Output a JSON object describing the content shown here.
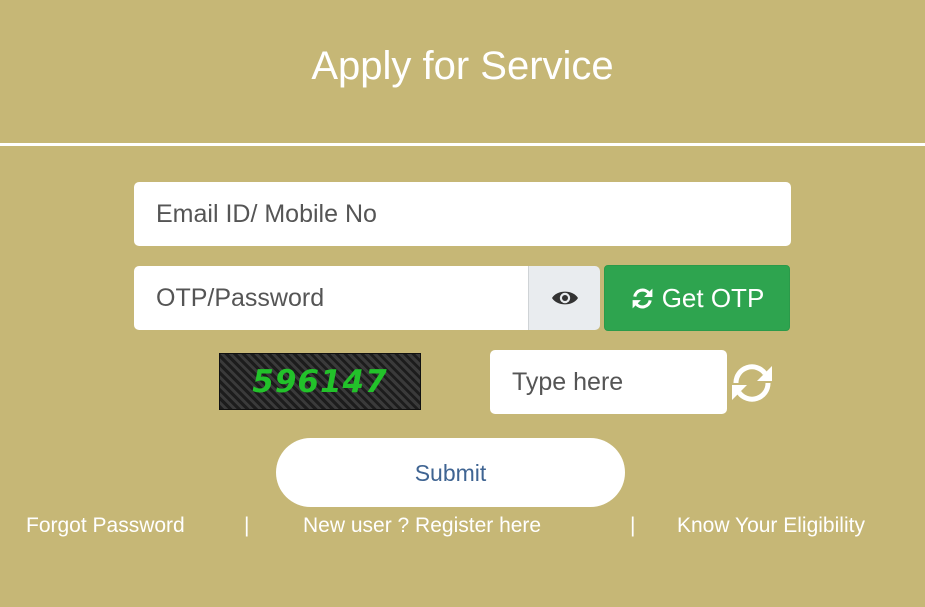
{
  "page": {
    "title": "Apply for Service"
  },
  "form": {
    "email_placeholder": "Email ID/ Mobile No",
    "otp_placeholder": "OTP/Password",
    "show_password_icon": "eye-icon",
    "get_otp": {
      "icon": "refresh-icon",
      "label": "Get OTP"
    },
    "captcha": {
      "code": "596147",
      "input_placeholder": "Type here",
      "refresh_icon": "refresh-icon"
    },
    "submit_label": "Submit"
  },
  "footer_links": {
    "forgot_password": "Forgot Password",
    "separator": "|",
    "register": "New user ? Register here",
    "eligibility": "Know Your Eligibility"
  },
  "colors": {
    "background": "#c6b776",
    "otp_button": "#2ea44f",
    "captcha_text": "#22c22a",
    "submit_text": "#3f6492"
  }
}
